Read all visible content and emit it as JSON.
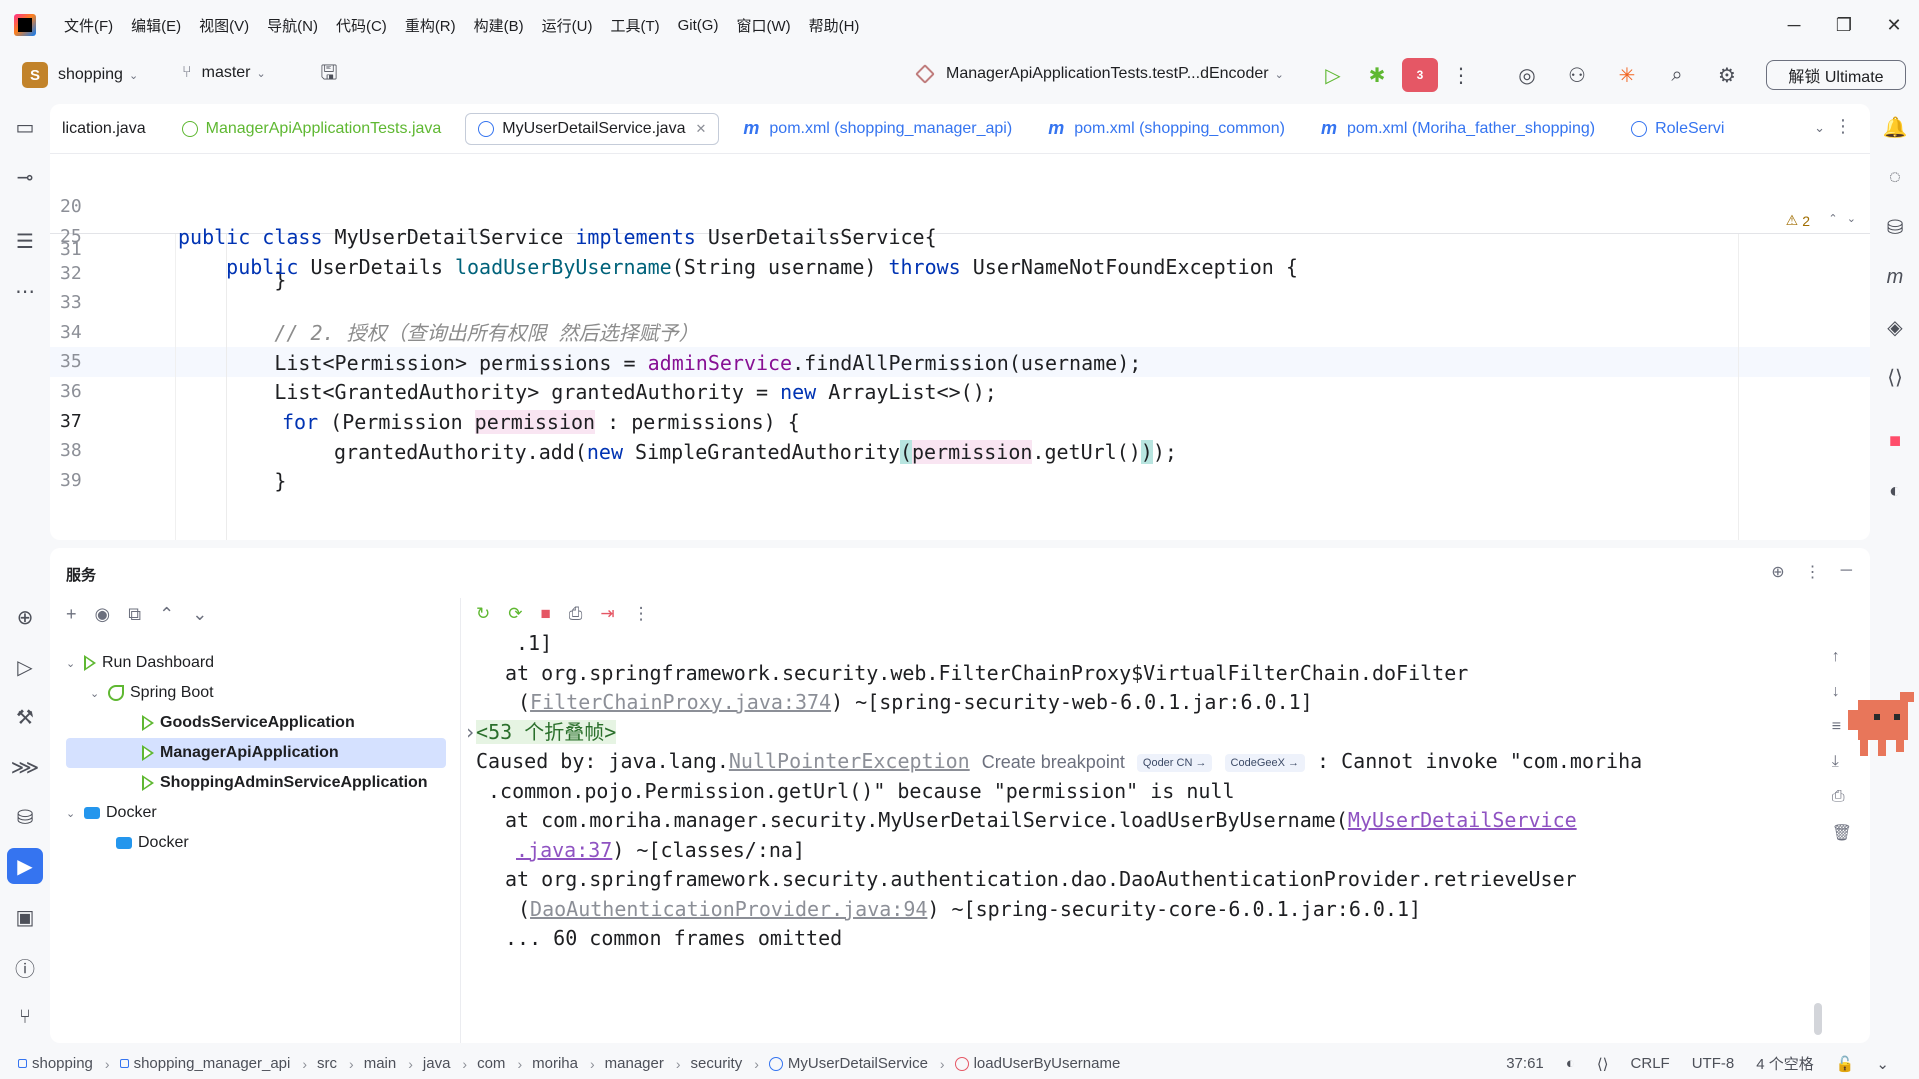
{
  "menu": [
    "文件(F)",
    "编辑(E)",
    "视图(V)",
    "导航(N)",
    "代码(C)",
    "重构(R)",
    "构建(B)",
    "运行(U)",
    "工具(T)",
    "Git(G)",
    "窗口(W)",
    "帮助(H)"
  ],
  "toolbar": {
    "project_letter": "S",
    "project": "shopping",
    "branch": "master",
    "run_config": "ManagerApiApplicationTests.testP...dEncoder",
    "stop_badge": "3",
    "ultimate": "解锁 Ultimate"
  },
  "tabs": [
    {
      "label": "lication.java"
    },
    {
      "label": "ManagerApiApplicationTests.java"
    },
    {
      "label": "MyUserDetailService.java"
    },
    {
      "label": "pom.xml (shopping_manager_api)"
    },
    {
      "label": "pom.xml (shopping_common)"
    },
    {
      "label": "pom.xml (Moriha_father_shopping)"
    },
    {
      "label": "RoleServi"
    }
  ],
  "editor": {
    "warnings": "2",
    "sticky": [
      {
        "ln": "20",
        "a": "public class ",
        "b": "MyUserDetailService ",
        "c": "implements ",
        "d": "UserDetailsService{"
      },
      {
        "ln": "25",
        "a": "    public ",
        "b": "UserDetails ",
        "c": "loadUserByUsername",
        "d": "(String username) ",
        "e": "throws ",
        "f": "UserNameNotFoundException {"
      }
    ],
    "lines": [
      {
        "ln": "31",
        "text": "        }"
      },
      {
        "ln": "32",
        "text": ""
      },
      {
        "ln": "33",
        "comment": "        // 2. 授权（查询出所有权限 然后选择赋予）"
      },
      {
        "ln": "34",
        "p1": "        List<Permission> permissions = ",
        "field": "adminService",
        "p2": ".findAllPermission(username);"
      },
      {
        "ln": "35",
        "p1": "        List<GrantedAuthority> grantedAuthority = ",
        "kw": "new",
        "p2": " ArrayList<>();"
      },
      {
        "ln": "36",
        "kw": "for",
        "p1": " (Permission ",
        "var": "permission",
        "p2": " : permissions) {"
      },
      {
        "ln": "37",
        "p1": "grantedAuthority.add(",
        "kw": "new",
        "p2": " SimpleGrantedAuthority",
        "var": "permission",
        "p3": ".getUrl()",
        "p4": ");"
      },
      {
        "ln": "38",
        "text": "        }"
      },
      {
        "ln": "39",
        "text": ""
      }
    ]
  },
  "services": {
    "title": "服务",
    "tree": {
      "run_dashboard": "Run Dashboard",
      "spring_boot": "Spring Boot",
      "apps": [
        "GoodsServiceApplication",
        "ManagerApiApplication",
        "ShoppingAdminServiceApplication"
      ],
      "docker_group": "Docker",
      "docker_item": "Docker"
    },
    "console": {
      "l1": ".1]",
      "l2": "at org.springframework.security.web.FilterChainProxy$VirtualFilterChain.doFilter",
      "l3_link": "FilterChainProxy.java:374",
      "l3_rest": ") ~[spring-security-web-6.0.1.jar:6.0.1]",
      "fold": "<53 个折叠帧>",
      "caused_by": "Caused by: java.lang.",
      "npe": "NullPointerException",
      "create_bp": "Create breakpoint",
      "chip1": "Qoder CN →",
      "chip2": "CodeGeeX →",
      "msg1": " : Cannot invoke \"com.moriha",
      "msg2": ".common.pojo.Permission.getUrl()\" because \"permission\" is null",
      "at1": "at com.moriha.manager.security.MyUserDetailService.loadUserByUsername(",
      "at1_link": "MyUserDetailService",
      "at1b_link": ".java:37",
      "at1b_rest": ") ~[classes/:na]",
      "at2": "at org.springframework.security.authentication.dao.DaoAuthenticationProvider.retrieveUser",
      "at2_link": "DaoAuthenticationProvider.java:94",
      "at2_rest": ") ~[spring-security-core-6.0.1.jar:6.0.1]",
      "omitted": "... 60 common frames omitted"
    }
  },
  "statusbar": {
    "crumbs": [
      "shopping",
      "shopping_manager_api",
      "src",
      "main",
      "java",
      "com",
      "moriha",
      "manager",
      "security",
      "MyUserDetailService",
      "loadUserByUsername"
    ],
    "position": "37:61",
    "line_sep": "CRLF",
    "encoding": "UTF-8",
    "indent": "4 个空格"
  }
}
